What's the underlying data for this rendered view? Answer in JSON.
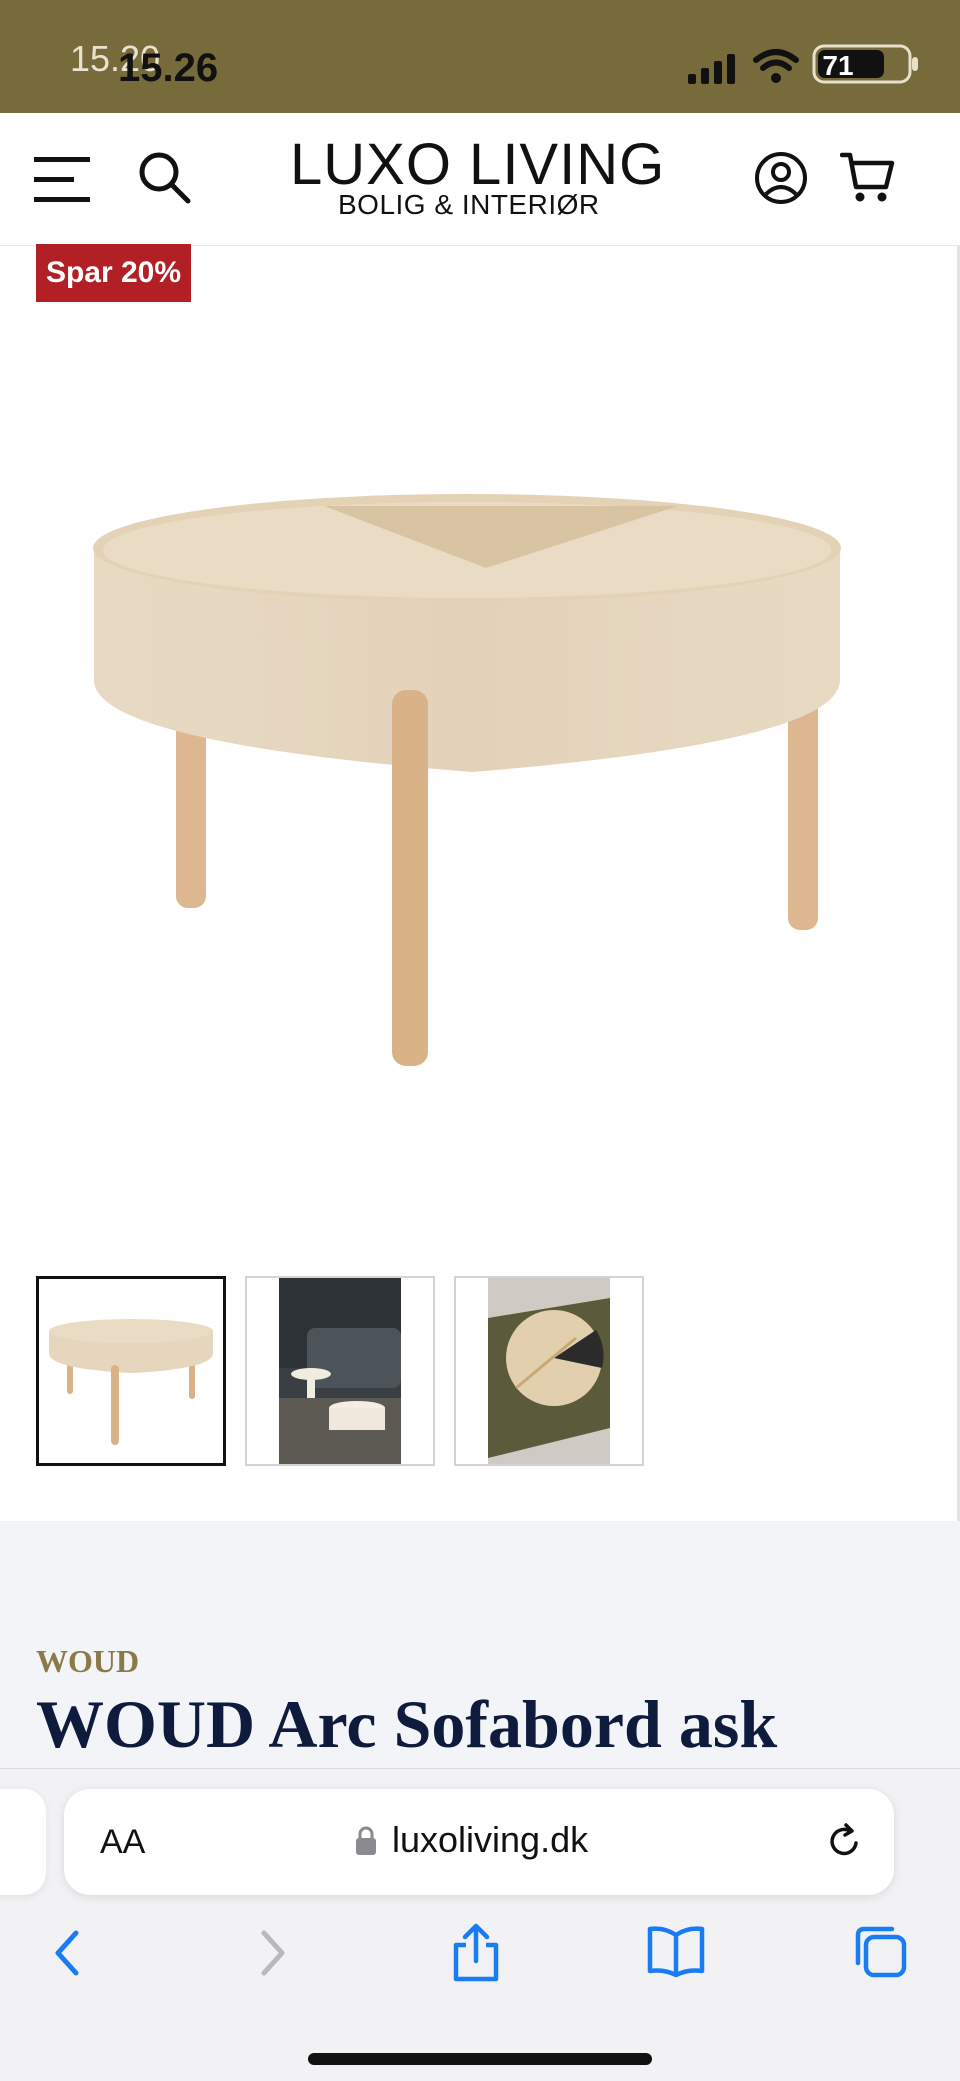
{
  "status_bar": {
    "time_ghost": "15.20",
    "time": "15.26",
    "battery": "71",
    "background_color": "#776a3b"
  },
  "header": {
    "logo_title": "LUXO LIVING",
    "logo_subtitle": "BOLIG & INTERIØR",
    "icons": [
      "menu-icon",
      "search-icon",
      "account-icon",
      "cart-icon"
    ]
  },
  "product": {
    "sale_badge": "Spar 20%",
    "sale_badge_color": "#b21f24",
    "brand": "WOUD",
    "title": "WOUD Arc Sofabord ask",
    "thumbnails": [
      "thumbnail-1",
      "thumbnail-2",
      "thumbnail-3"
    ],
    "active_thumbnail": 1
  },
  "browser": {
    "text_size_label": "AA",
    "url": "luxoliving.dk",
    "toolbar_icons": [
      "back-icon",
      "forward-icon",
      "share-icon",
      "bookmarks-icon",
      "tabs-icon"
    ],
    "accent_color": "#1a7cf5"
  }
}
